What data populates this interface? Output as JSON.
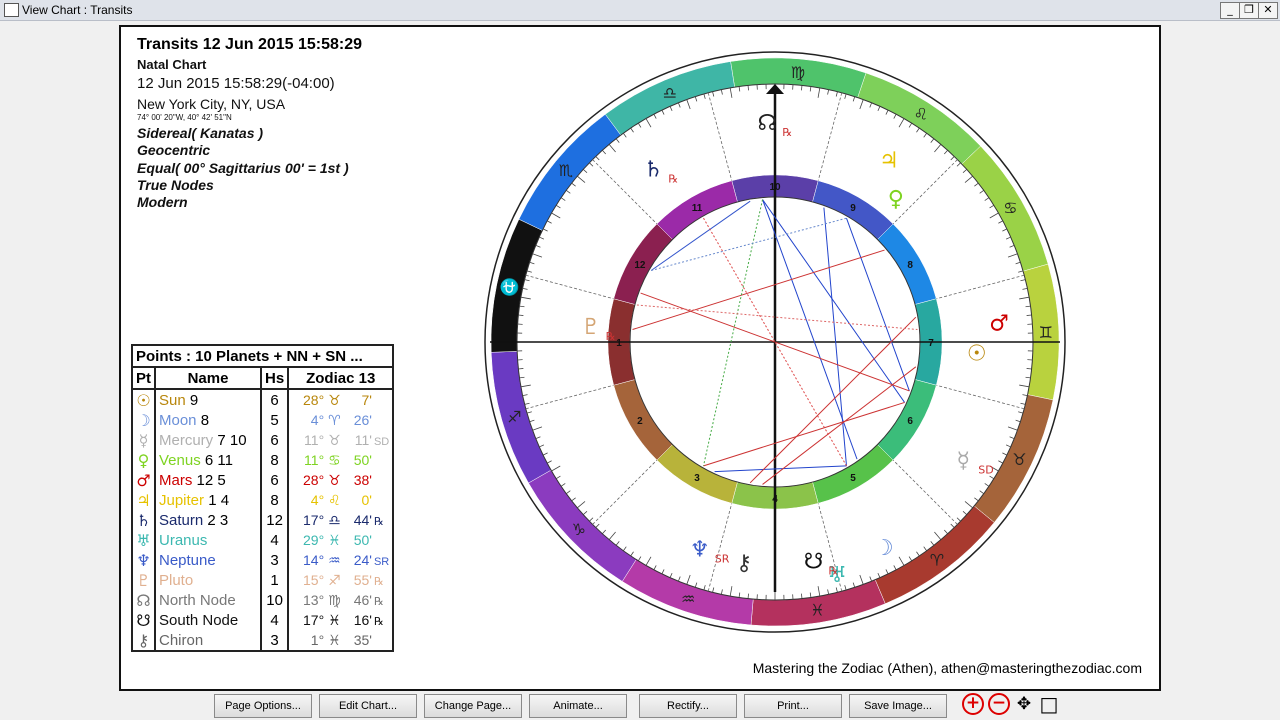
{
  "window": {
    "title": "View Chart : Transits"
  },
  "header": {
    "title": "Transits 12 Jun 2015 15:58:29",
    "subtitle": "Natal Chart",
    "datetime": "12 Jun 2015 15:58:29(-04:00)",
    "location": "New York City, NY, USA",
    "coords": "74° 00' 20\"W, 40° 42' 51\"N",
    "options": [
      "Sidereal( Kanatas )",
      "Geocentric",
      "Equal( 00° Sagittarius 00' = 1st )",
      "True Nodes",
      "Modern"
    ]
  },
  "table": {
    "caption": "Points : 10 Planets + NN + SN ...",
    "headers": [
      "Pt",
      "Name",
      "Hs",
      "Zodiac 13"
    ],
    "rows": [
      {
        "glyph": "☉",
        "name": "Sun",
        "nums": " 9",
        "hs": "6",
        "deg": "28°",
        "sign": "♉",
        "min": "7'",
        "flag": "",
        "color": "#b8860b"
      },
      {
        "glyph": "☽",
        "name": "Moon",
        "nums": " 8",
        "hs": "5",
        "deg": "4°",
        "sign": "♈",
        "min": "26'",
        "flag": "",
        "color": "#6a8fd8"
      },
      {
        "glyph": "☿",
        "name": "Mercury",
        "nums": " 7 10",
        "hs": "6",
        "deg": "11°",
        "sign": "♉",
        "min": "11'",
        "flag": "SD",
        "color": "#b0b0b0"
      },
      {
        "glyph": "♀",
        "name": "Venus",
        "nums": " 6  11",
        "hs": "8",
        "deg": "11°",
        "sign": "♋",
        "min": "50'",
        "flag": "",
        "color": "#7ed321"
      },
      {
        "glyph": "♂",
        "name": "Mars",
        "nums": " 12 5",
        "hs": "6",
        "deg": "28°",
        "sign": "♉",
        "min": "38'",
        "flag": "",
        "color": "#cc0000"
      },
      {
        "glyph": "♃",
        "name": "Jupiter",
        "nums": " 1 4",
        "hs": "8",
        "deg": "4°",
        "sign": "♌",
        "min": "0'",
        "flag": "",
        "color": "#e6c200"
      },
      {
        "glyph": "♄",
        "name": "Saturn",
        "nums": " 2 3",
        "hs": "12",
        "deg": "17°",
        "sign": "♎",
        "min": "44'",
        "flag": "℞",
        "color": "#1a2a6c"
      },
      {
        "glyph": "♅",
        "name": "Uranus",
        "nums": "",
        "hs": "4",
        "deg": "29°",
        "sign": "♓",
        "min": "50'",
        "flag": "",
        "color": "#3cb8b0"
      },
      {
        "glyph": "♆",
        "name": "Neptune",
        "nums": "",
        "hs": "3",
        "deg": "14°",
        "sign": "♒",
        "min": "24'",
        "flag": "SR",
        "color": "#3a5bc8"
      },
      {
        "glyph": "♇",
        "name": "Pluto",
        "nums": "",
        "hs": "1",
        "deg": "15°",
        "sign": "♐",
        "min": "55'",
        "flag": "℞",
        "color": "#e0b090"
      },
      {
        "glyph": "☊",
        "name": "North Node",
        "nums": "",
        "hs": "10",
        "deg": "13°",
        "sign": "♍",
        "min": "46'",
        "flag": "℞",
        "color": "#777777"
      },
      {
        "glyph": "☋",
        "name": "South Node",
        "nums": "",
        "hs": "4",
        "deg": "17°",
        "sign": "♓",
        "min": "16'",
        "flag": "℞",
        "color": "#111111"
      },
      {
        "glyph": "⚷",
        "name": "Chiron",
        "nums": "",
        "hs": "3",
        "deg": "1°",
        "sign": "♓",
        "min": "35'",
        "flag": "",
        "color": "#666666"
      }
    ]
  },
  "footer": "Mastering the Zodiac (Athen), athen@masteringthezodiac.com",
  "buttons": [
    "Page Options...",
    "Edit Chart...",
    "Change Page...",
    "Animate...",
    "Rectify...",
    "Print...",
    "Save Image..."
  ],
  "zoom": {
    "in": "+",
    "out": "−",
    "pan": "✥",
    "fit": "□"
  },
  "wheel": {
    "signs": [
      "♍",
      "♌",
      "♋",
      "♊",
      "♉",
      "♈",
      "♓",
      "♒",
      "♑",
      "♐",
      "⛎",
      "♏",
      "♎"
    ],
    "sign_colors": [
      "#4fc36b",
      "#7ed05a",
      "#9ad247",
      "#b9d23e",
      "#a5643a",
      "#a83a2f",
      "#b4315e",
      "#b43aa8",
      "#8b3bbf",
      "#6a3ac2",
      "#111111",
      "#1e6fe0",
      "#3fb6a6"
    ],
    "houses": [
      "10",
      "9",
      "8",
      "7",
      "6",
      "5",
      "4",
      "3",
      "2",
      "1",
      "12",
      "11"
    ],
    "house_colors": [
      "#5b3fa8",
      "#4357c7",
      "#1e88e5",
      "#28a8a0",
      "#3bbd7a",
      "#57c24a",
      "#8bc34a",
      "#b8b33a",
      "#a5643a",
      "#8a2f2f",
      "#8b2050",
      "#9b2aa8"
    ],
    "outer_planets": [
      {
        "glyph": "☊",
        "flag": "℞",
        "color": "#222222"
      },
      {
        "glyph": "♃",
        "flag": "",
        "color": "#e6c200"
      },
      {
        "glyph": "♀",
        "flag": "",
        "color": "#7ed321"
      },
      {
        "glyph": "♄",
        "flag": "℞",
        "color": "#1a2a6c"
      },
      {
        "glyph": "♂",
        "flag": "",
        "color": "#cc0000"
      },
      {
        "glyph": "☉",
        "flag": "",
        "color": "#b8860b"
      },
      {
        "glyph": "♇",
        "flag": "℞",
        "color": "#d4a574"
      },
      {
        "glyph": "☿",
        "flag": "SD",
        "color": "#aaaaaa"
      },
      {
        "glyph": "☽",
        "flag": "",
        "color": "#6a8fd8"
      },
      {
        "glyph": "♅",
        "flag": "",
        "color": "#3cb8b0"
      },
      {
        "glyph": "☋",
        "flag": "℞",
        "color": "#111111"
      },
      {
        "glyph": "⚷",
        "flag": "",
        "color": "#333333"
      },
      {
        "glyph": "♆",
        "flag": "SR",
        "color": "#3a5bc8"
      }
    ]
  }
}
